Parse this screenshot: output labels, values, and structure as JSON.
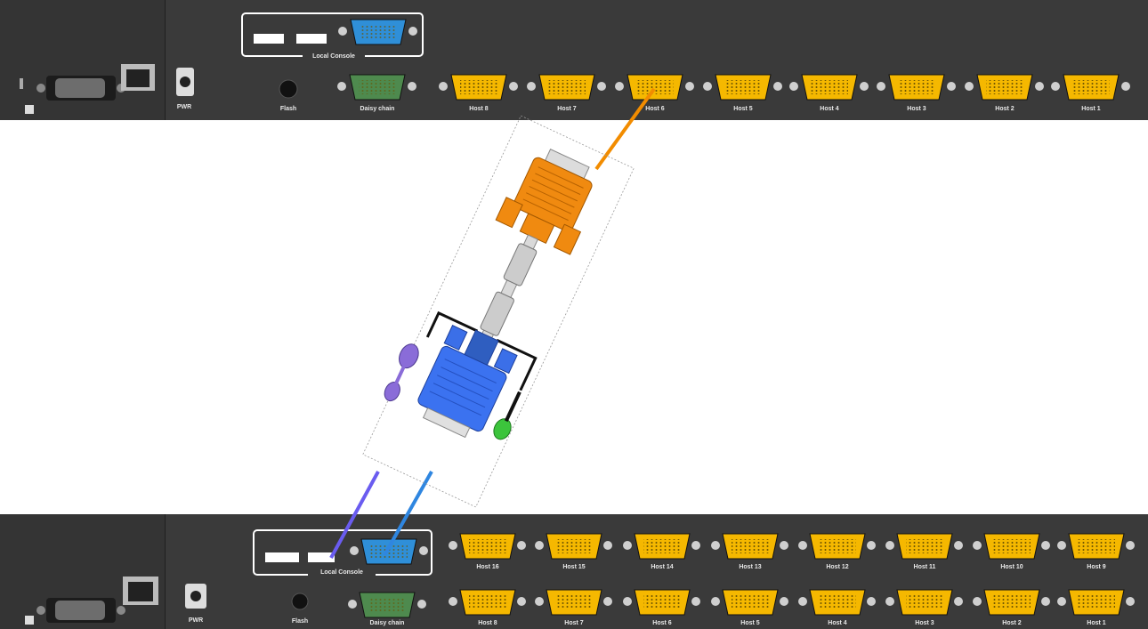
{
  "top_panel": {
    "local_console_label": "Local Console",
    "flash_label": "Flash",
    "daisy_chain_label": "Daisy chain",
    "power_label": "PWR",
    "host_labels": [
      "Host 8",
      "Host 7",
      "Host 6",
      "Host 5",
      "Host 4",
      "Host 3",
      "Host 2",
      "Host 1"
    ]
  },
  "bottom_panel": {
    "local_console_label": "Local Console",
    "flash_label": "Flash",
    "daisy_chain_label": "Daisy chain",
    "power_label": "PWR",
    "host_labels_top_row": [
      "Host 16",
      "Host 15",
      "Host 14",
      "Host 13",
      "Host 12",
      "Host 11",
      "Host 10",
      "Host 9"
    ],
    "host_labels_bottom_row": [
      "Host 8",
      "Host 7",
      "Host 6",
      "Host 5",
      "Host 4",
      "Host 3",
      "Host 2",
      "Host 1"
    ]
  },
  "colors": {
    "panel": "#3a3a3a",
    "vga_host_port": "#f5b800",
    "vga_console_port": "#2f8fd8",
    "daisy_chain_port": "#4e8a4e",
    "cable_orange": "#f28c00",
    "cable_blue": "#2f86e0",
    "cable_purple": "#6a5cf0",
    "connector_blue": "#3b6fe8",
    "connector_orange": "#f08a10",
    "ps2_purple": "#8a6cd8",
    "ps2_green": "#3cc43c"
  }
}
